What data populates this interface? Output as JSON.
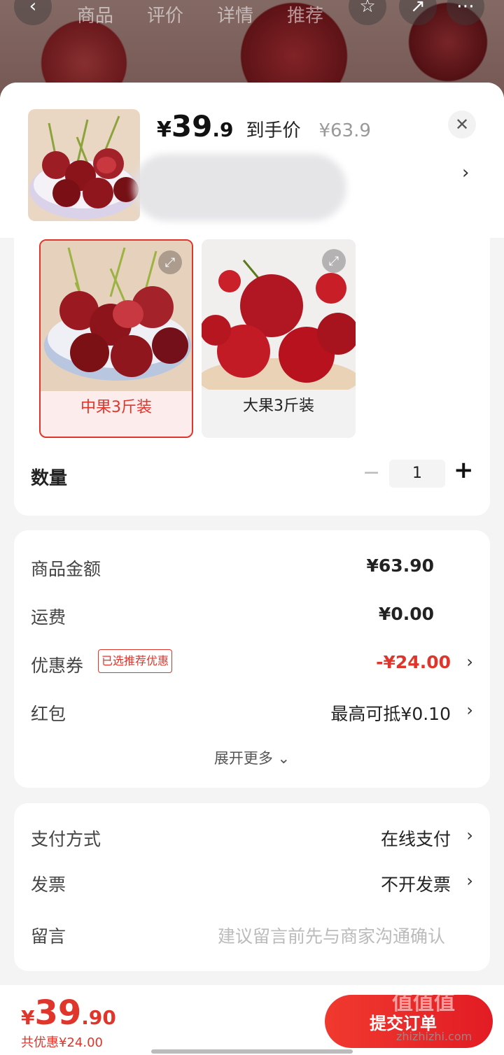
{
  "background_nav": {
    "back_icon": "back-icon",
    "tabs": [
      "商品",
      "评价",
      "详情",
      "推荐"
    ],
    "star_icon": "star-icon",
    "share_icon": "share-icon",
    "more_icon": "more-icon"
  },
  "header": {
    "price_symbol": "¥",
    "price_integer": "39",
    "price_decimal": ".9",
    "price_label": "到手价",
    "original_price": "¥63.9",
    "close_icon": "close-icon"
  },
  "options": [
    {
      "label": "中果3斤装",
      "selected": true
    },
    {
      "label": "大果3斤装",
      "selected": false
    }
  ],
  "quantity": {
    "label": "数量",
    "value": "1",
    "minus": "−",
    "plus": "+"
  },
  "summary": {
    "goods_amount_label": "商品金额",
    "goods_amount": "¥63.90",
    "shipping_label": "运费",
    "shipping": "¥0.00",
    "coupon_label": "优惠券",
    "coupon_badge": "已选推荐优惠",
    "coupon_value": "-¥24.00",
    "redpacket_label": "红包",
    "redpacket_value": "最高可抵¥0.10",
    "expand_more": "展开更多 ⌄"
  },
  "payment": {
    "method_label": "支付方式",
    "method_value": "在线支付",
    "invoice_label": "发票",
    "invoice_value": "不开发票",
    "message_label": "留言",
    "message_placeholder": "建议留言前先与商家沟通确认"
  },
  "footer": {
    "total_symbol": "¥",
    "total_integer": "39",
    "total_decimal": ".90",
    "total_saving": "共优惠¥24.00",
    "submit_label": "提交订单",
    "watermark": "值值值",
    "watermark_url": "zhizhizhi.com"
  },
  "colors": {
    "accent": "#e0352b"
  }
}
